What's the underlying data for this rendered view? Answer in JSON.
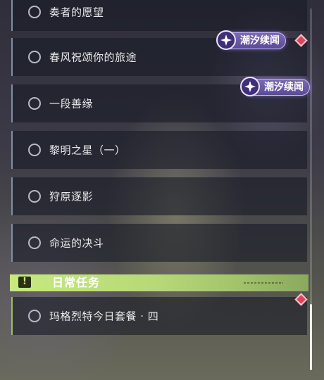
{
  "quests": [
    {
      "label": "奏者的愿望"
    },
    {
      "label": "春风祝颂你的旅途"
    },
    {
      "label": "一段善缘"
    },
    {
      "label": "黎明之星（一）"
    },
    {
      "label": "狩原逐影"
    },
    {
      "label": "命运的决斗"
    }
  ],
  "tags": [
    {
      "label": "潮汐续闻"
    },
    {
      "label": "潮汐续闻"
    }
  ],
  "section": {
    "icon_text": "!",
    "title": "日常任务",
    "color": "#c6ea80"
  },
  "daily_quests": [
    {
      "label": "玛格烈特今日套餐 · 四"
    }
  ],
  "colors": {
    "tag": "#6a5aa8",
    "new_marker": "#e0445b",
    "row_bg": "#1c1f2a"
  },
  "icons": {
    "tag": "tidal-star-icon",
    "status": "radio-circle-icon",
    "new": "red-diamond-icon",
    "section": "exclamation-box-icon"
  }
}
